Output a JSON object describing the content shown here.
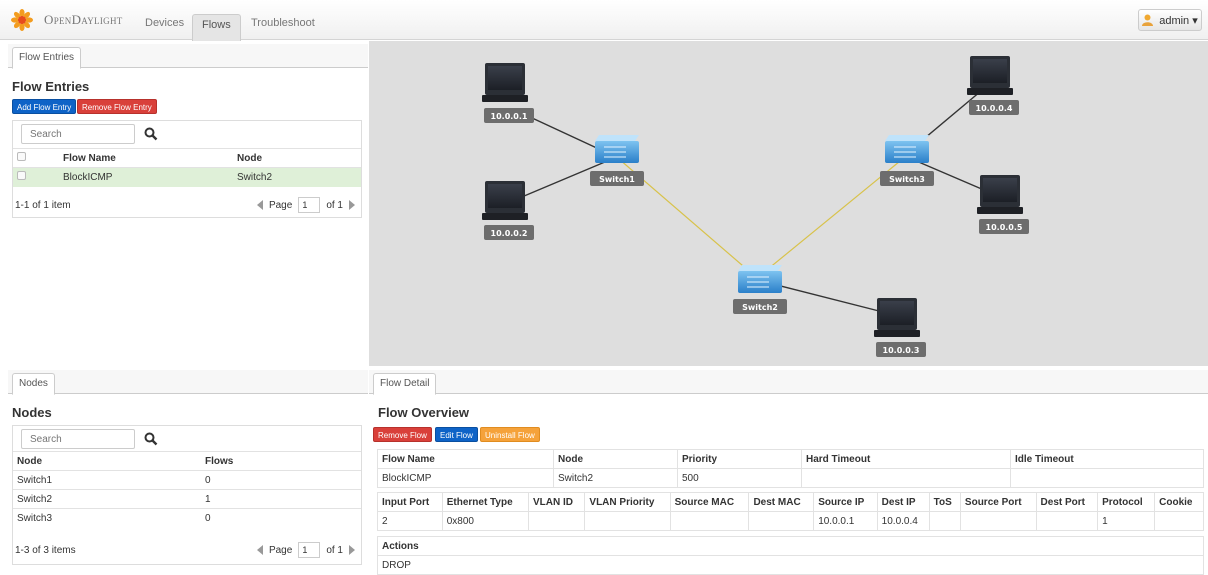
{
  "nav": {
    "brand": "OpenDaylight",
    "tabs": [
      "Devices",
      "Flows",
      "Troubleshoot"
    ],
    "active_tab": "Flows",
    "user": "admin ▾"
  },
  "flow_entries": {
    "tab_label": "Flow Entries",
    "title": "Flow Entries",
    "add_label": "Add Flow Entry",
    "remove_label": "Remove Flow Entry",
    "search_placeholder": "Search",
    "columns": [
      "Flow Name",
      "Node"
    ],
    "rows": [
      {
        "name": "BlockICMP",
        "node": "Switch2"
      }
    ],
    "summary": "1-1 of 1 item",
    "page_label": "Page",
    "page_value": "1",
    "page_of": "of 1"
  },
  "nodes": {
    "tab_label": "Nodes",
    "title": "Nodes",
    "search_placeholder": "Search",
    "columns": [
      "Node",
      "Flows"
    ],
    "rows": [
      {
        "node": "Switch1",
        "flows": "0"
      },
      {
        "node": "Switch2",
        "flows": "1"
      },
      {
        "node": "Switch3",
        "flows": "0"
      }
    ],
    "summary": "1-3 of 3 items",
    "page_label": "Page",
    "page_value": "1",
    "page_of": "of 1"
  },
  "topology": {
    "hosts": [
      "10.0.0.1",
      "10.0.0.2",
      "10.0.0.3",
      "10.0.0.4",
      "10.0.0.5"
    ],
    "switches": [
      "Switch1",
      "Switch2",
      "Switch3"
    ]
  },
  "flow_detail": {
    "tab_label": "Flow Detail",
    "title": "Flow Overview",
    "remove_label": "Remove Flow",
    "edit_label": "Edit Flow",
    "uninstall_label": "Uninstall Flow",
    "summary_headers": [
      "Flow Name",
      "Node",
      "Priority",
      "Hard Timeout",
      "Idle Timeout"
    ],
    "summary_values": [
      "BlockICMP",
      "Switch2",
      "500",
      "",
      ""
    ],
    "match_headers": [
      "Input Port",
      "Ethernet Type",
      "VLAN ID",
      "VLAN Priority",
      "Source MAC",
      "Dest MAC",
      "Source IP",
      "Dest IP",
      "ToS",
      "Source Port",
      "Dest Port",
      "Protocol",
      "Cookie"
    ],
    "match_values": [
      "2",
      "0x800",
      "",
      "",
      "",
      "",
      "10.0.0.1",
      "10.0.0.4",
      "",
      "",
      "",
      "1",
      ""
    ],
    "actions_header": "Actions",
    "actions_value": "DROP"
  },
  "colors": {
    "primary_button": "#0e63c7",
    "danger_button": "#d9403a",
    "warning_button": "#f5a23a",
    "selected_row": "#dff0d8",
    "topology_bg": "#dedede",
    "host_link": "#333333",
    "switch_link": "#d8c24a"
  }
}
